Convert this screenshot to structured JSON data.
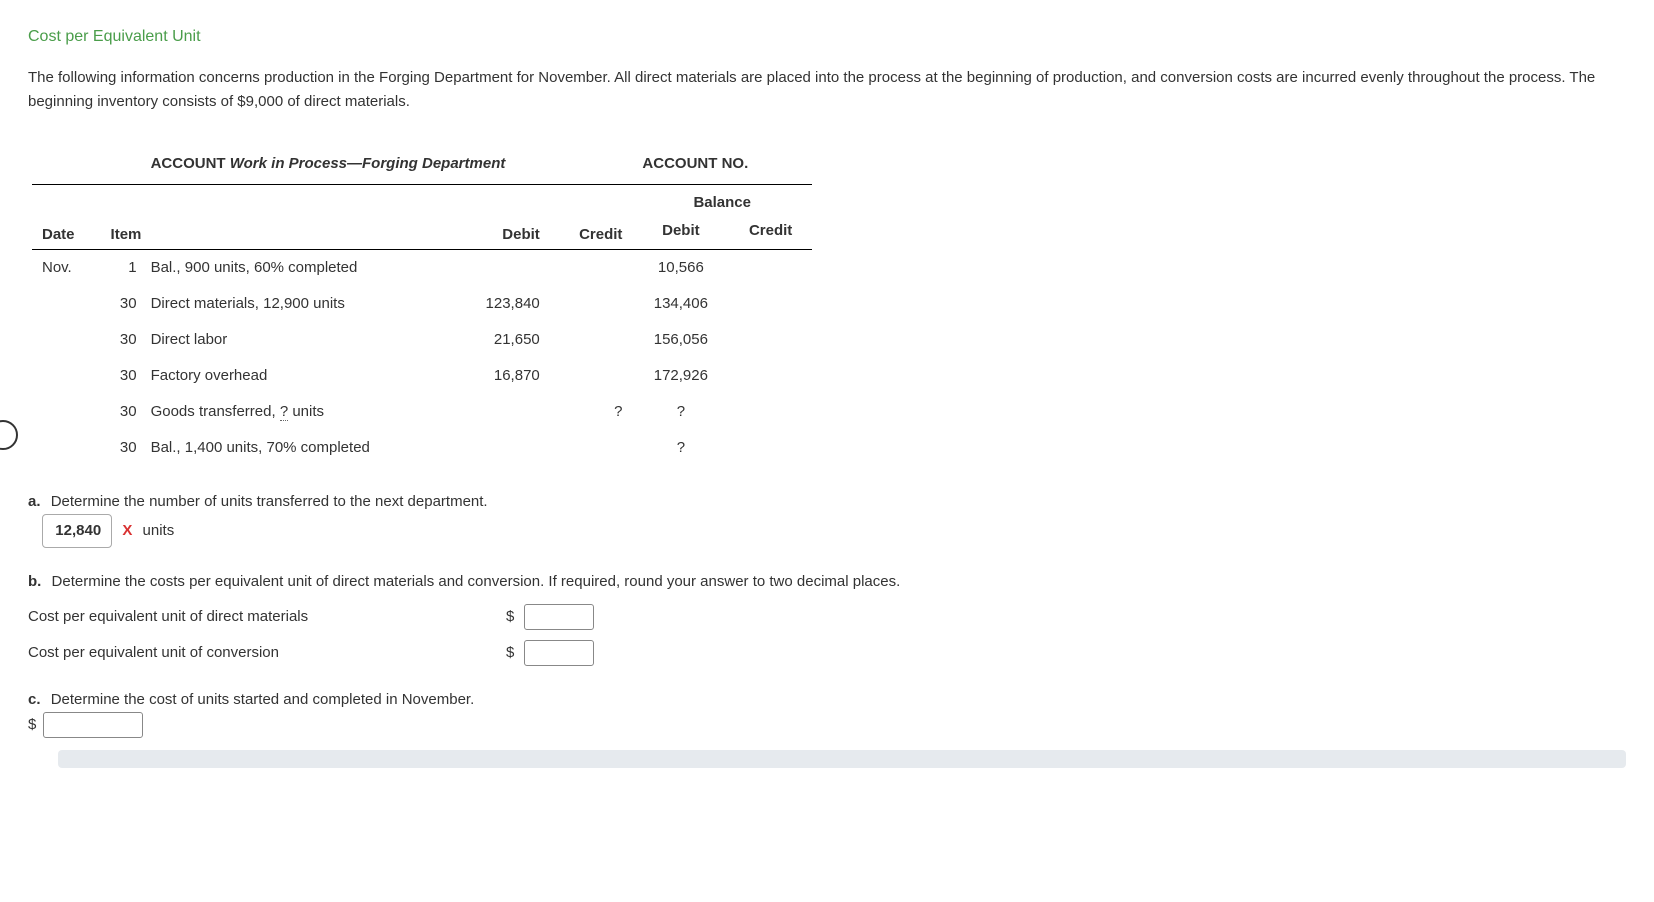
{
  "title": "Cost per Equivalent Unit",
  "intro": "The following information concerns production in the Forging Department for November. All direct materials are placed into the process at the beginning of production, and conversion costs are incurred evenly throughout the process. The beginning inventory consists of $9,000 of direct materials.",
  "ledger": {
    "account_label": "ACCOUNT",
    "account_name": "Work in Process—Forging Department",
    "account_no_label": "ACCOUNT NO.",
    "headers": {
      "date": "Date",
      "item": "Item",
      "debit": "Debit",
      "credit": "Credit",
      "balance": "Balance",
      "bal_debit": "Debit",
      "bal_credit": "Credit"
    },
    "month": "Nov.",
    "rows": [
      {
        "day": "1",
        "item": "Bal., 900 units, 60% completed",
        "debit": "",
        "credit": "",
        "bal_debit": "10,566",
        "bal_credit": ""
      },
      {
        "day": "30",
        "item": "Direct materials, 12,900 units",
        "debit": "123,840",
        "credit": "",
        "bal_debit": "134,406",
        "bal_credit": ""
      },
      {
        "day": "30",
        "item": "Direct labor",
        "debit": "21,650",
        "credit": "",
        "bal_debit": "156,056",
        "bal_credit": ""
      },
      {
        "day": "30",
        "item": "Factory overhead",
        "debit": "16,870",
        "credit": "",
        "bal_debit": "172,926",
        "bal_credit": ""
      },
      {
        "day": "30",
        "item": "Goods transferred, ? units",
        "debit": "",
        "credit": "?",
        "bal_debit": "?",
        "bal_credit": ""
      },
      {
        "day": "30",
        "item": "Bal., 1,400 units, 70% completed",
        "debit": "",
        "credit": "",
        "bal_debit": "?",
        "bal_credit": ""
      }
    ]
  },
  "questions": {
    "a": {
      "label": "a.",
      "text": "Determine the number of units transferred to the next department.",
      "answer": "12,840",
      "wrong_mark": "X",
      "unit": "units"
    },
    "b": {
      "label": "b.",
      "text": "Determine the costs per equivalent unit of direct materials and conversion. If required, round your answer to two decimal places.",
      "row1_label": "Cost per equivalent unit of direct materials",
      "row2_label": "Cost per equivalent unit of conversion",
      "currency": "$"
    },
    "c": {
      "label": "c.",
      "text": "Determine the cost of units started and completed in November.",
      "currency": "$"
    }
  }
}
